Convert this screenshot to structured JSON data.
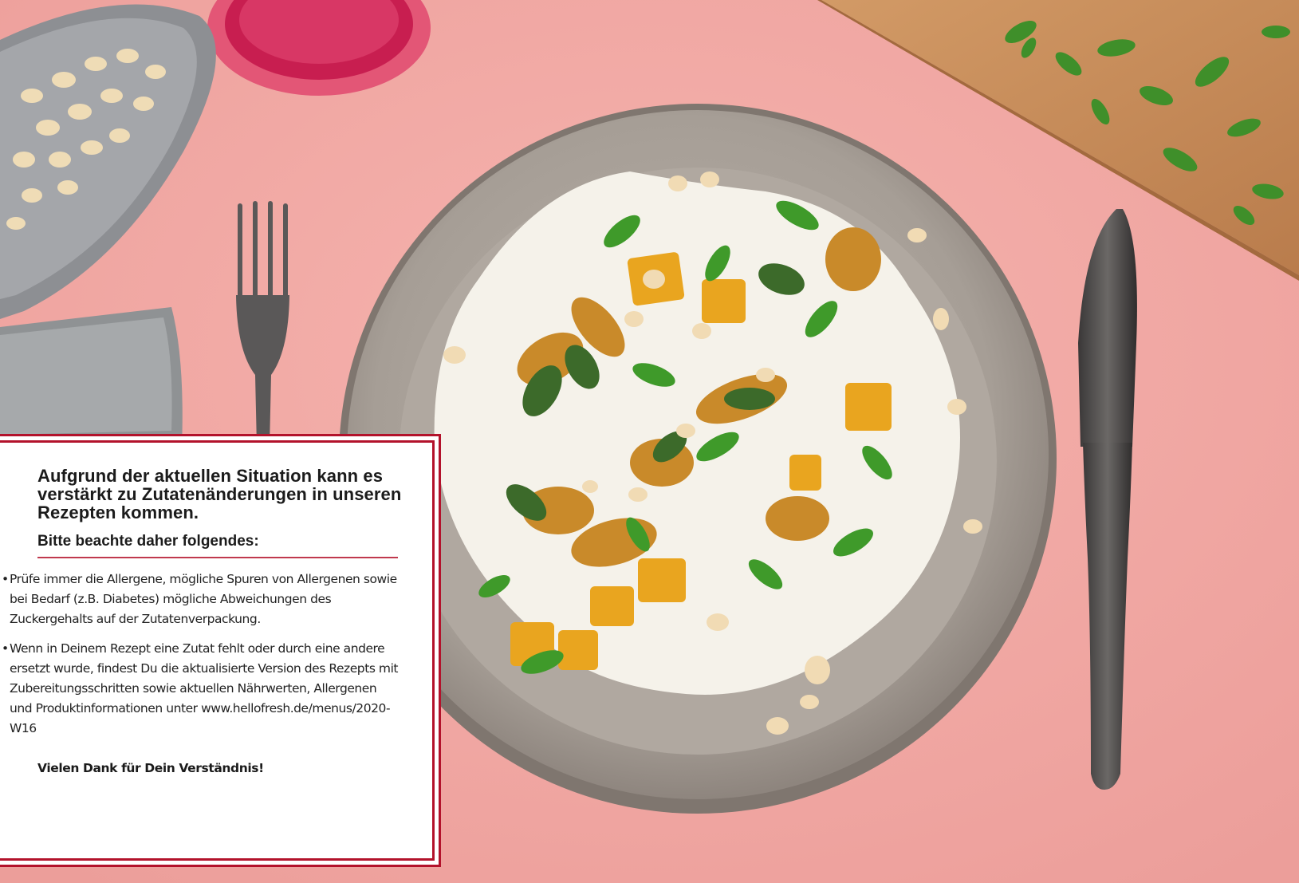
{
  "notice": {
    "headline": "Aufgrund der aktuellen Situation kann es verstärkt zu Zutatenänderungen in unseren Rezepten kommen.",
    "subheading": "Bitte beachte daher folgendes:",
    "bullets": [
      "Prüfe immer die Allergene, mögliche Spuren von Allergenen sowie bei Bedarf (z.B. Diabetes) mögliche Abweichungen des Zuckergehalts auf der Zutatenverpackung.",
      "Wenn in Deinem Rezept eine Zutat fehlt oder durch eine andere ersetzt wurde, findest Du die aktualisierte Version des Rezepts mit Zubereitungsschritten sowie aktuellen Nährwerten, Allergenen und Produktinformationen unter www.hellofresh.de/menus/2020-W16"
    ],
    "thanks": "Vielen Dank für Dein Verständnis!"
  },
  "colors": {
    "background": "#f2aaa6",
    "accent": "#b3122b",
    "plate": "#a59c94"
  }
}
